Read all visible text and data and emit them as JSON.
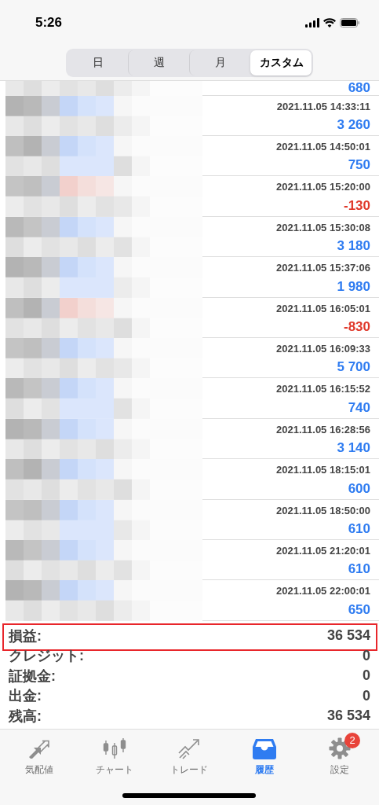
{
  "status_bar": {
    "time": "5:26"
  },
  "period_tabs": [
    {
      "label": "日",
      "selected": false
    },
    {
      "label": "週",
      "selected": false
    },
    {
      "label": "月",
      "selected": false
    },
    {
      "label": "カスタム",
      "selected": true
    }
  ],
  "history": {
    "partial_first_row": {
      "value": "680",
      "kind": "profit"
    },
    "rows": [
      {
        "time": "2021.11.05 14:33:11",
        "value": "3 260",
        "kind": "profit"
      },
      {
        "time": "2021.11.05 14:50:01",
        "value": "750",
        "kind": "profit"
      },
      {
        "time": "2021.11.05 15:20:00",
        "value": "-130",
        "kind": "loss"
      },
      {
        "time": "2021.11.05 15:30:08",
        "value": "3 180",
        "kind": "profit"
      },
      {
        "time": "2021.11.05 15:37:06",
        "value": "1 980",
        "kind": "profit"
      },
      {
        "time": "2021.11.05 16:05:01",
        "value": "-830",
        "kind": "loss"
      },
      {
        "time": "2021.11.05 16:09:33",
        "value": "5 700",
        "kind": "profit"
      },
      {
        "time": "2021.11.05 16:15:52",
        "value": "740",
        "kind": "profit"
      },
      {
        "time": "2021.11.05 16:28:56",
        "value": "3 140",
        "kind": "profit"
      },
      {
        "time": "2021.11.05 18:15:01",
        "value": "600",
        "kind": "profit"
      },
      {
        "time": "2021.11.05 18:50:00",
        "value": "610",
        "kind": "profit"
      },
      {
        "time": "2021.11.05 21:20:01",
        "value": "610",
        "kind": "profit"
      },
      {
        "time": "2021.11.05 22:00:01",
        "value": "650",
        "kind": "profit"
      }
    ]
  },
  "summary": [
    {
      "label": "損益:",
      "value": "36 534",
      "highlighted": true
    },
    {
      "label": "クレジット:",
      "value": "0",
      "highlighted": false
    },
    {
      "label": "証拠金:",
      "value": "0",
      "highlighted": false
    },
    {
      "label": "出金:",
      "value": "0",
      "highlighted": false
    },
    {
      "label": "残高:",
      "value": "36 534",
      "highlighted": false
    }
  ],
  "tab_bar": [
    {
      "label": "気配値",
      "selected": false
    },
    {
      "label": "チャート",
      "selected": false
    },
    {
      "label": "トレード",
      "selected": false
    },
    {
      "label": "履歴",
      "selected": true
    },
    {
      "label": "設定",
      "selected": false,
      "badge": "2"
    }
  ]
}
